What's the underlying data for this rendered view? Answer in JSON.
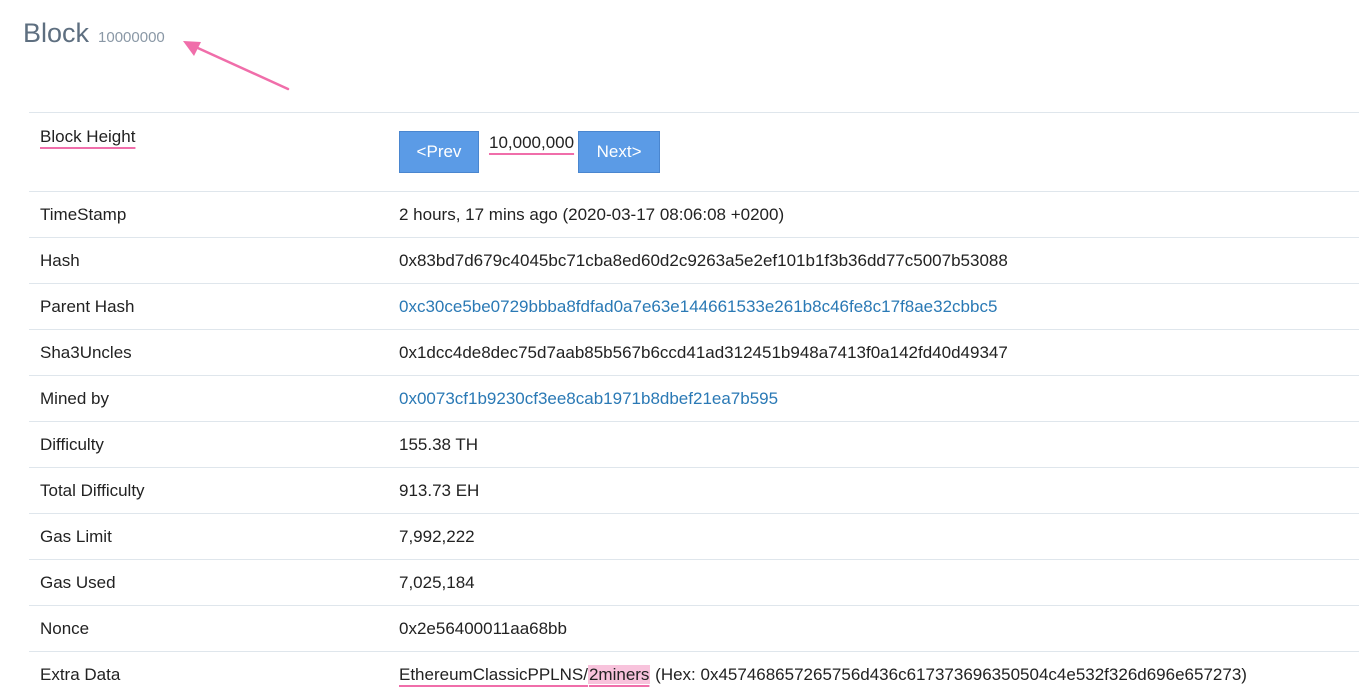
{
  "header": {
    "title": "Block",
    "block_number": "10000000"
  },
  "colors": {
    "accent_button": "#5b9be6",
    "link": "#2a79b5",
    "annotation_pink": "#f06eaa",
    "highlight_pink": "#f8c3dc"
  },
  "block_height": {
    "label": "Block Height",
    "prev_label": "<Prev",
    "value": "10,000,000",
    "next_label": "Next>"
  },
  "rows": {
    "timestamp": {
      "label": "TimeStamp",
      "value": "2 hours, 17 mins ago (2020-03-17 08:06:08 +0200)"
    },
    "hash": {
      "label": "Hash",
      "value": "0x83bd7d679c4045bc71cba8ed60d2c9263a5e2ef101b1f3b36dd77c5007b53088"
    },
    "parent_hash": {
      "label": "Parent Hash",
      "value": "0xc30ce5be0729bbba8fdfad0a7e63e144661533e261b8c46fe8c17f8ae32cbbc5"
    },
    "sha3uncles": {
      "label": "Sha3Uncles",
      "value": "0x1dcc4de8dec75d7aab85b567b6ccd41ad312451b948a7413f0a142fd40d49347"
    },
    "mined_by": {
      "label": "Mined by",
      "value": "0x0073cf1b9230cf3ee8cab1971b8dbef21ea7b595"
    },
    "difficulty": {
      "label": "Difficulty",
      "value": "155.38 TH"
    },
    "total_difficulty": {
      "label": "Total Difficulty",
      "value": "913.73 EH"
    },
    "gas_limit": {
      "label": "Gas Limit",
      "value": "7,992,222"
    },
    "gas_used": {
      "label": "Gas Used",
      "value": "7,025,184"
    },
    "nonce": {
      "label": "Nonce",
      "value": "0x2e56400011aa68bb"
    },
    "extra_data": {
      "label": "Extra Data",
      "value_main": "EthereumClassicPPLNS/",
      "value_highlight": "2miners",
      "value_hex": " (Hex: 0x457468657265756d436c617373696350504c4e532f326d696e657273)"
    }
  }
}
